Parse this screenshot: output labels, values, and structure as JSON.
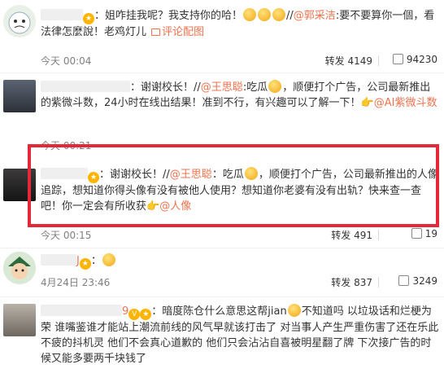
{
  "comments": [
    {
      "id": "c1",
      "segments": [
        "姐咋挂我呢？我支持你的哈！",
        "//",
        "@郭采洁",
        ":要不要算你一個，看法律怎麼說！老鸡灯儿 ",
        "评论配图"
      ],
      "time": "今天 00:04",
      "repost_label": "转发",
      "repost_count": "4149",
      "like_count": "94230"
    },
    {
      "id": "c2",
      "segments": [
        "谢谢校长！",
        "//",
        "@王思聪",
        ":吃瓜",
        "，顺便打个广告，公司最新推出的紫微斗数，24小时在线出结果！准到不行，有兴趣可以了解一下！",
        "@AI紫微斗数"
      ],
      "time": "今天 00:21"
    },
    {
      "id": "c3",
      "segments": [
        "谢谢校长！",
        "//",
        "@王思聪",
        "：吃瓜",
        "，顺便打个广告，公司最新推出的人像追踪，想知道你得头像有没有被他人使用？想知道你老婆有没有出轨？快来查一查吧！你一定会有所收获",
        "@人像"
      ],
      "time": "今天 00:15",
      "repost_label": "转发",
      "repost_count": "491",
      "like_count": "19"
    },
    {
      "id": "c4",
      "name": "J",
      "time": "4月24日 23:46",
      "repost_label": "转发",
      "repost_count": "837",
      "like_count": "3249"
    },
    {
      "id": "c5",
      "name": "9",
      "segments": [
        "暗度陈仓什么意思这帮jian",
        "不知道吗 以垃圾话和烂梗为荣 谁嘴鉴谁才能站上潮流前线的风气早就该打击了 对当事人产生严重伤害了还在乐此不疲的抖机灵 他们不会真心道歉的 他们只会沾沾自喜被明星翻了牌 下次接广告的时候又能多要两千块钱了"
      ]
    }
  ],
  "colors": {
    "link": "#eb7350",
    "highlight_border": "#e3283a",
    "meta_text": "#808080"
  }
}
